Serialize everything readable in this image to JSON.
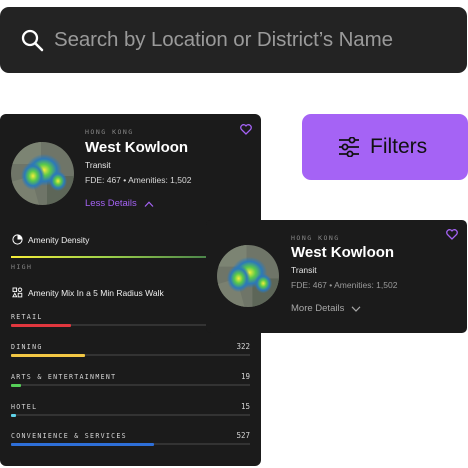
{
  "search": {
    "placeholder": "Search by Location or District’s Name",
    "icon": "search-icon"
  },
  "filters": {
    "label": "Filters",
    "icon": "sliders-icon",
    "color": "#a563f5"
  },
  "card_expanded": {
    "city": "HONG KONG",
    "district": "West Kowloon",
    "transit": "Transit",
    "stats": "FDE: 467 • Amenities: 1,502",
    "toggle_label": "Less Details",
    "amenity_density_label": "Amenity Density",
    "density_level": "HIGH",
    "amenity_mix_label": "Amenity Mix In a 5 Min Radius Walk",
    "mix": [
      {
        "category": "RETAIL",
        "count": "",
        "fill_fraction": 0.25,
        "color": "#e1373e"
      },
      {
        "category": "DINING",
        "count": "322",
        "fill_fraction": 0.31,
        "color": "#f2c744"
      },
      {
        "category": "ARTS & ENTERTAINMENT",
        "count": "19",
        "fill_fraction": 0.04,
        "color": "#56cf58"
      },
      {
        "category": "HOTEL",
        "count": "15",
        "fill_fraction": 0.02,
        "color": "#5fd2e8"
      },
      {
        "category": "CONVENIENCE & SERVICES",
        "count": "527",
        "fill_fraction": 0.6,
        "color": "#2e6fd8"
      }
    ]
  },
  "card_collapsed": {
    "city": "HONG KONG",
    "district": "West Kowloon",
    "transit": "Transit",
    "stats": "FDE: 467 • Amenities: 1,502",
    "toggle_label": "More Details"
  },
  "colors": {
    "accent": "#a563f5",
    "card_bg": "#1b1b1b",
    "search_bg": "#232323"
  }
}
